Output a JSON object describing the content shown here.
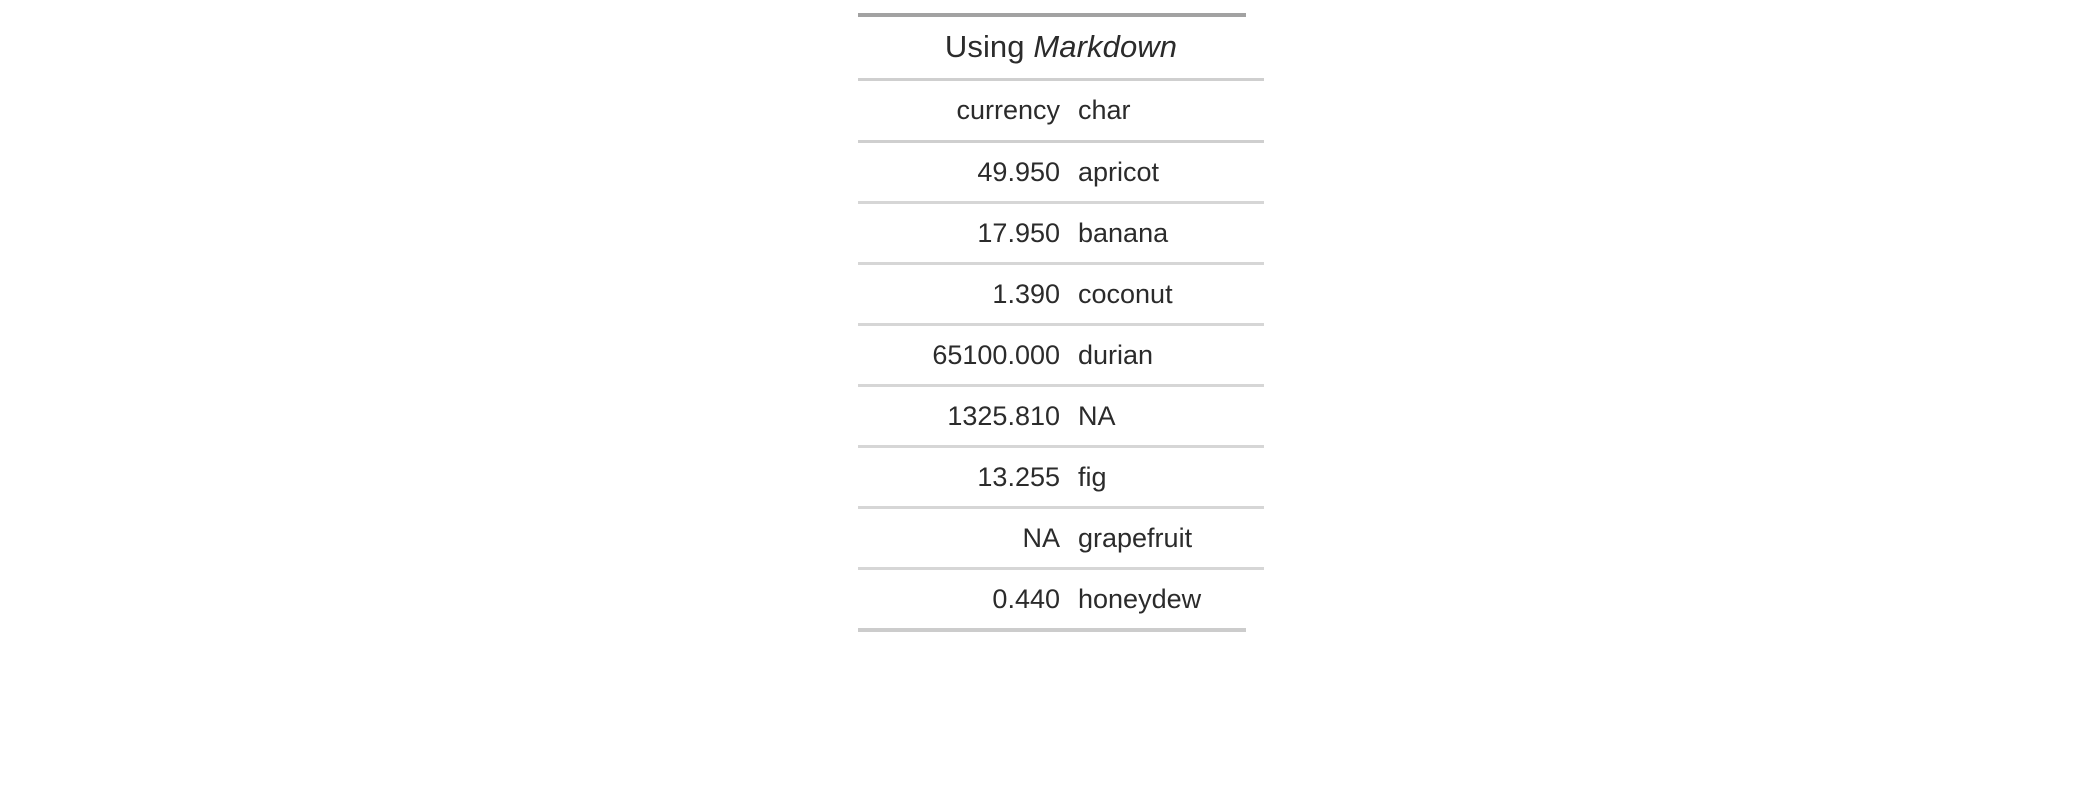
{
  "document": {
    "background_color": "#ffffff",
    "text_color": "#2b2b2b"
  },
  "table": {
    "title_plain": "Using ",
    "title_emphasis": "Markdown",
    "title_full": "Using Markdown",
    "rule_color_top": "#a2a2a2",
    "rule_color_inner": "#d6d6d6",
    "rule_color_bottom": "#cccccc",
    "columns": [
      {
        "key": "currency",
        "header": "currency",
        "align": "right"
      },
      {
        "key": "char",
        "header": "char",
        "align": "left"
      }
    ],
    "rows": [
      {
        "currency": "49.950",
        "char": "apricot"
      },
      {
        "currency": "17.950",
        "char": "banana"
      },
      {
        "currency": "1.390",
        "char": "coconut"
      },
      {
        "currency": "65100.000",
        "char": "durian"
      },
      {
        "currency": "1325.810",
        "char": "NA"
      },
      {
        "currency": "13.255",
        "char": "fig"
      },
      {
        "currency": "NA",
        "char": "grapefruit"
      },
      {
        "currency": "0.440",
        "char": "honeydew"
      }
    ]
  }
}
